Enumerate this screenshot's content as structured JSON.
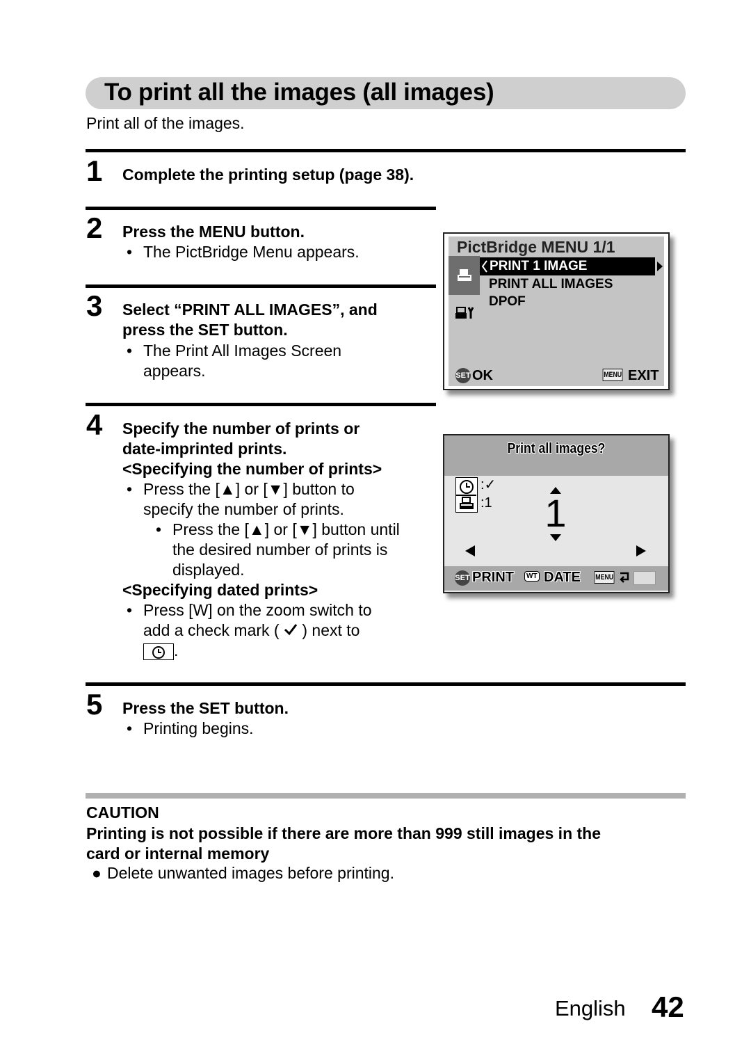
{
  "page": {
    "title": "To print all the images (all images)",
    "intro": "Print all of the images.",
    "language": "English",
    "page_number": "42"
  },
  "steps": [
    {
      "number": "1",
      "heading": "Complete the printing setup (page 38)."
    },
    {
      "number": "2",
      "heading": "Press the MENU button.",
      "bullets": [
        "The PictBridge Menu appears."
      ]
    },
    {
      "number": "3",
      "heading_lines": [
        "Select “PRINT ALL IMAGES”, and",
        "press the SET button."
      ],
      "bullets_lines": [
        "The Print All Images Screen",
        "appears."
      ]
    },
    {
      "number": "4",
      "heading_lines": [
        "Specify the number of prints or",
        "date-imprinted prints."
      ],
      "sub1": "<Specifying the number of prints>",
      "sub1_bullet_lines": [
        "Press the [▲] or [▼] button to",
        "specify the number of prints."
      ],
      "sub1_subbullet_lines": [
        "Press the [▲] or [▼] button until",
        "the desired number of prints is",
        "displayed."
      ],
      "sub2": "<Specifying dated prints>",
      "sub2_bullet_lines": [
        "Press [W] on the zoom switch to",
        "add a check mark (",
        ") next to",
        "."
      ]
    },
    {
      "number": "5",
      "heading": "Press the SET button.",
      "bullets": [
        "Printing begins."
      ]
    }
  ],
  "caution": {
    "label": "CAUTION",
    "heading_lines": [
      "Printing is not possible if there are more than 999 still images in the",
      "card or internal memory"
    ],
    "bullet": "Delete unwanted images before printing."
  },
  "screen1": {
    "title": "PictBridge MENU 1/1",
    "items": [
      "PRINT 1 IMAGE",
      "PRINT ALL IMAGES",
      "DPOF"
    ],
    "selected_index": 0,
    "footer_left_icon": "SET",
    "footer_left": "OK",
    "footer_right_icon": "MENU",
    "footer_right": "EXIT"
  },
  "screen2": {
    "prompt": "Print all images?",
    "date_value": ":✓",
    "prints_value": ":1",
    "count": "1",
    "footer": {
      "set_icon": "SET",
      "print": "PRINT",
      "wt_icon": "WT",
      "date": "DATE",
      "menu_icon": "MENU"
    }
  }
}
